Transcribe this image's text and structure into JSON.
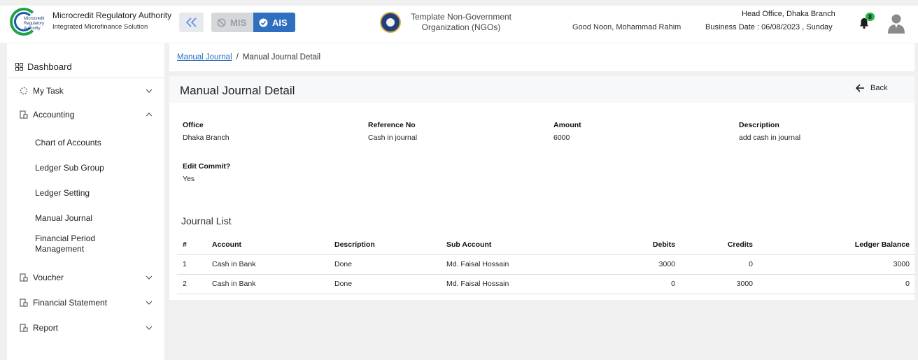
{
  "header": {
    "logo_text": [
      "Microcredit",
      "Regulatory",
      "Authority"
    ],
    "app_title": "Microcredit Regulatory Authority",
    "app_subtitle": "Integrated Microfinance Solution",
    "mode_mis": "MIS",
    "mode_ais": "AIS",
    "org_line1": "Template Non-Government",
    "org_line2": "Organization (NGOs)",
    "greeting": "Good Noon, Mohammad Rahim",
    "office": "Head Office, Dhaka Branch",
    "business_date": "Business Date : 06/08/2023 , Sunday",
    "notification_count": "8",
    "colors": {
      "accent": "#2e6fc0",
      "badge": "#2ab34a",
      "logo_green": "#1fa24a"
    },
    "icons": [
      "double-chevron-left-icon",
      "ban-icon",
      "check-circle-icon",
      "bell-icon",
      "user-avatar-icon"
    ]
  },
  "sidebar": {
    "dashboard": "Dashboard",
    "items": [
      {
        "label": "My Task",
        "icon": "spinner-icon",
        "expanded": false
      },
      {
        "label": "Accounting",
        "icon": "ledger-icon",
        "expanded": true
      },
      {
        "label": "Voucher",
        "icon": "ledger-icon",
        "expanded": false
      },
      {
        "label": "Financial Statement",
        "icon": "ledger-icon",
        "expanded": false
      },
      {
        "label": "Report",
        "icon": "ledger-icon",
        "expanded": false
      }
    ],
    "accounting_sub": [
      "Chart of Accounts",
      "Ledger Sub Group",
      "Ledger Setting",
      "Manual Journal",
      "Financial Period Management"
    ]
  },
  "breadcrumb": {
    "link": "Manual Journal",
    "separator": "/",
    "current": "Manual Journal Detail"
  },
  "detail": {
    "title": "Manual Journal Detail",
    "back_label": "Back",
    "fields": [
      {
        "label": "Office",
        "value": "Dhaka Branch"
      },
      {
        "label": "Reference No",
        "value": "Cash in journal"
      },
      {
        "label": "Amount",
        "value": "6000"
      },
      {
        "label": "Description",
        "value": "add cash in journal"
      },
      {
        "label": "Edit Commit?",
        "value": "Yes"
      }
    ]
  },
  "journal": {
    "title": "Journal List",
    "columns": [
      "#",
      "Account",
      "Description",
      "Sub Account",
      "Debits",
      "Credits",
      "Ledger Balance"
    ],
    "rows": [
      [
        "1",
        "Cash in Bank",
        "Done",
        "Md. Faisal Hossain",
        "3000",
        "0",
        "3000"
      ],
      [
        "2",
        "Cash in Bank",
        "Done",
        "Md. Faisal Hossain",
        "0",
        "3000",
        "0"
      ]
    ]
  }
}
